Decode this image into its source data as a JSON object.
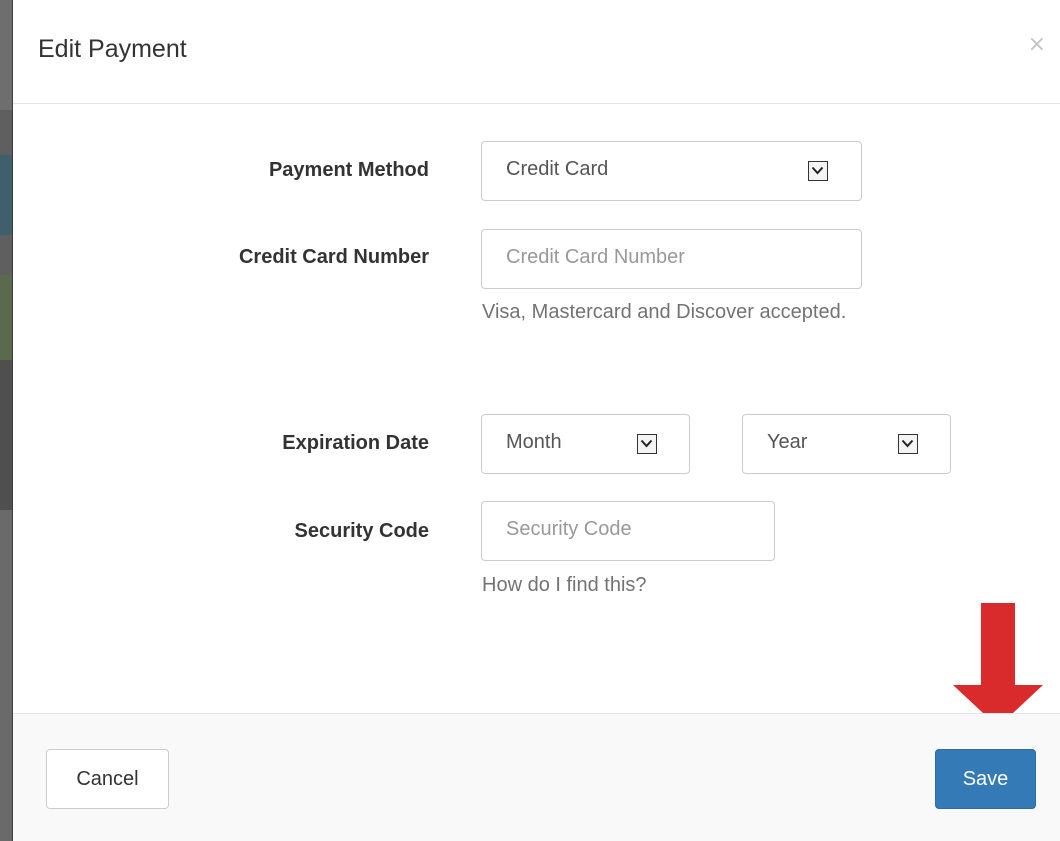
{
  "modal": {
    "title": "Edit Payment",
    "close_glyph": "×"
  },
  "form": {
    "payment_method": {
      "label": "Payment Method",
      "selected": "Credit Card"
    },
    "card_number": {
      "label": "Credit Card Number",
      "placeholder": "Credit Card Number",
      "value": "",
      "help": "Visa, Mastercard and Discover accepted."
    },
    "expiration": {
      "label": "Expiration Date",
      "month_selected": "Month",
      "year_selected": "Year"
    },
    "security_code": {
      "label": "Security Code",
      "placeholder": "Security Code",
      "value": "",
      "help": "How do I find this?"
    }
  },
  "footer": {
    "cancel_label": "Cancel",
    "save_label": "Save"
  },
  "colors": {
    "primary": "#337ab7",
    "annotation": "#d92b2b"
  },
  "icons": {
    "close": "close-icon",
    "select_arrow": "chevron-down-icon",
    "annotation": "arrow-down-icon"
  }
}
